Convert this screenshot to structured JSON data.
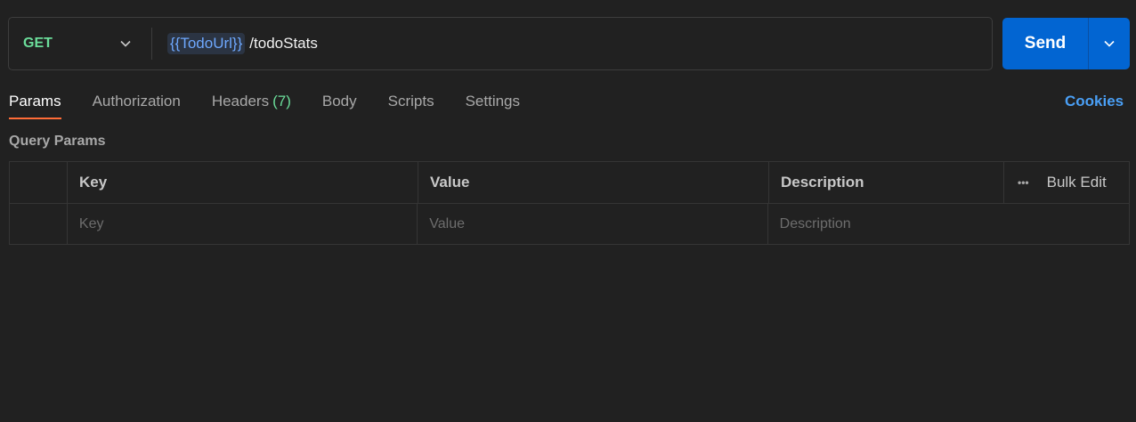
{
  "request": {
    "method": "GET",
    "url_variable": "{{TodoUrl}}",
    "url_path": "/todoStats"
  },
  "send": {
    "label": "Send"
  },
  "tabs": [
    {
      "label": "Params",
      "active": true
    },
    {
      "label": "Authorization"
    },
    {
      "label": "Headers",
      "count": "(7)"
    },
    {
      "label": "Body"
    },
    {
      "label": "Scripts"
    },
    {
      "label": "Settings"
    }
  ],
  "cookies_label": "Cookies",
  "query_params": {
    "title": "Query Params",
    "columns": {
      "key": "Key",
      "value": "Value",
      "description": "Description"
    },
    "bulk_edit_label": "Bulk Edit",
    "more_icon": "•••",
    "placeholders": {
      "key": "Key",
      "value": "Value",
      "description": "Description"
    }
  },
  "colors": {
    "method_get": "#6bdd9a",
    "send_button": "#0265d2",
    "active_tab_underline": "#ff6c37",
    "variable_text": "#6ea8fe",
    "cookies_link": "#4a9ff5"
  }
}
